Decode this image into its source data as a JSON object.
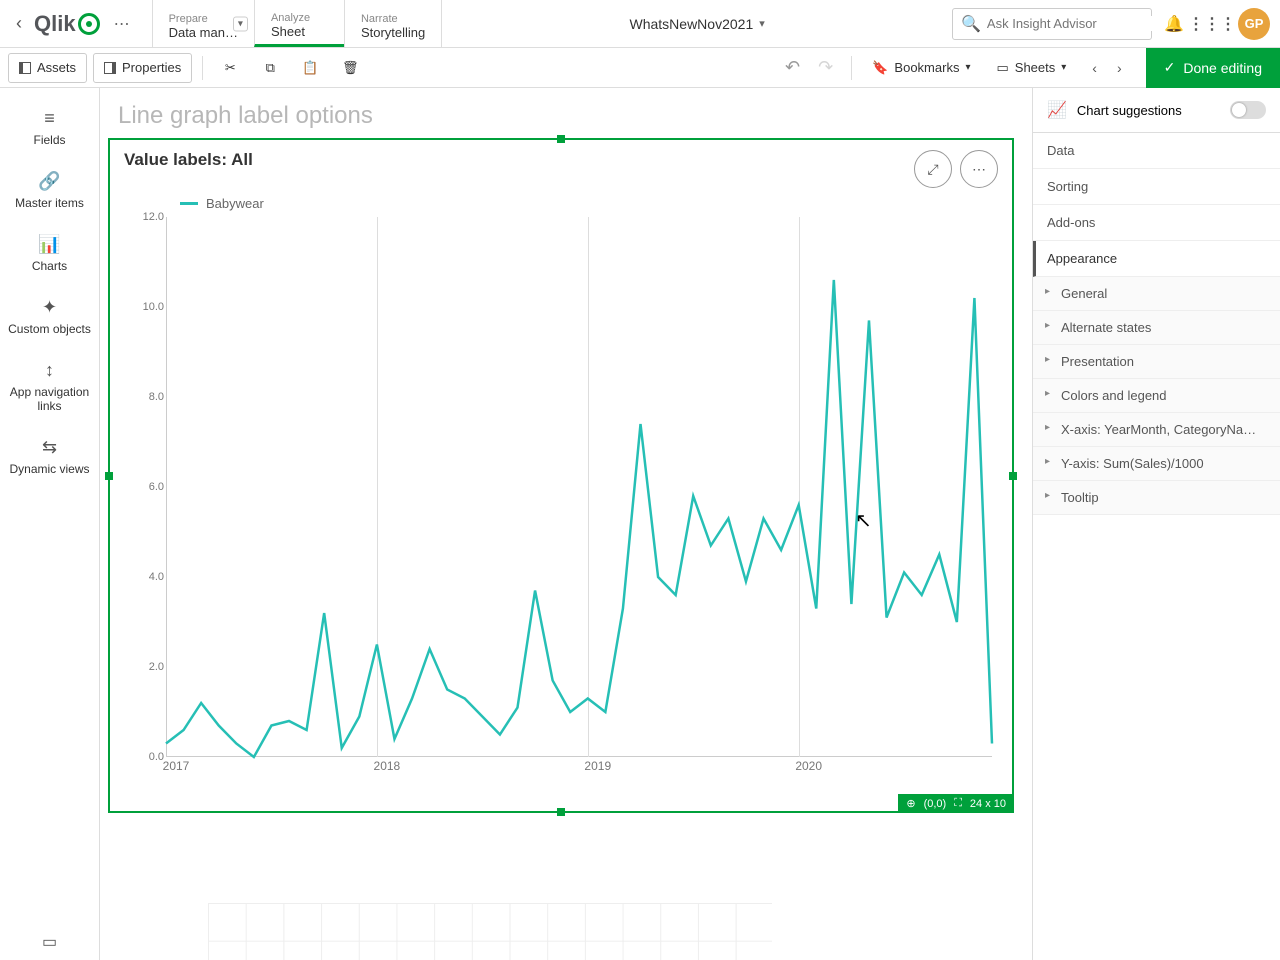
{
  "header": {
    "app_name": "WhatsNewNov2021",
    "search_placeholder": "Ask Insight Advisor",
    "avatar_initials": "GP",
    "nav": [
      {
        "sup": "Prepare",
        "main": "Data man…"
      },
      {
        "sup": "Analyze",
        "main": "Sheet"
      },
      {
        "sup": "Narrate",
        "main": "Storytelling"
      }
    ]
  },
  "toolbar": {
    "assets_label": "Assets",
    "properties_label": "Properties",
    "bookmarks_label": "Bookmarks",
    "sheets_label": "Sheets",
    "done_label": "Done editing"
  },
  "left_sidebar": {
    "items": [
      "Fields",
      "Master items",
      "Charts",
      "Custom objects",
      "App navigation links",
      "Dynamic views"
    ]
  },
  "sheet": {
    "title": "Line graph label options",
    "chart_title": "Value labels: All",
    "coord_pos": "(0,0)",
    "coord_size": "24 x 10"
  },
  "right_panel": {
    "suggestions_label": "Chart suggestions",
    "sections": [
      "Data",
      "Sorting",
      "Add-ons",
      "Appearance"
    ],
    "active_section": "Appearance",
    "appearance_subs": [
      "General",
      "Alternate states",
      "Presentation",
      "Colors and legend",
      "X-axis: YearMonth, CategoryNa…",
      "Y-axis: Sum(Sales)/1000",
      "Tooltip"
    ]
  },
  "chart_data": {
    "type": "line",
    "title": "Value labels: All",
    "series_name": "Babywear",
    "ylim": [
      0,
      12
    ],
    "y_ticks": [
      "0.0",
      "2.0",
      "4.0",
      "6.0",
      "8.0",
      "10.0",
      "12.0"
    ],
    "x_year_labels": [
      "2017",
      "2018",
      "2019",
      "2020"
    ],
    "x_year_positions": [
      0,
      12,
      24,
      36
    ],
    "n_points": 47,
    "values": [
      0.3,
      0.6,
      1.2,
      0.7,
      0.3,
      0.0,
      0.7,
      0.8,
      0.6,
      3.2,
      0.2,
      0.9,
      2.5,
      0.4,
      1.3,
      2.4,
      1.5,
      1.3,
      0.9,
      0.5,
      1.1,
      3.7,
      1.7,
      1.0,
      1.3,
      1.0,
      3.3,
      7.4,
      4.0,
      3.6,
      5.8,
      4.7,
      5.3,
      3.9,
      5.3,
      4.6,
      5.6,
      3.3,
      10.6,
      3.4,
      9.7,
      3.1,
      4.1,
      3.6,
      4.5,
      3.0,
      10.2,
      0.3
    ],
    "color": "#26bfb5"
  }
}
